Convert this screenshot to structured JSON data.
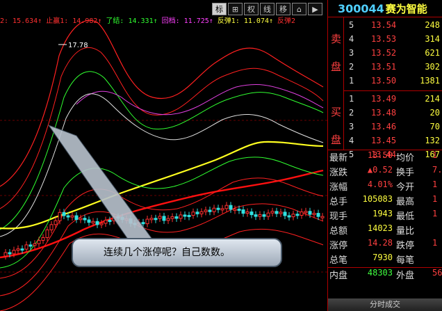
{
  "indicators": [
    {
      "text": "2: 15.634↑",
      "color": "#ff3030"
    },
    {
      "text": "止赢1: 14.982↑",
      "color": "#ff3030"
    },
    {
      "text": "了结: 14.331↑",
      "color": "#30ff30"
    },
    {
      "text": "回档: 11.725↑",
      "color": "#ff40ff"
    },
    {
      "text": "反弹1: 11.074↑",
      "color": "#ffff40"
    },
    {
      "text": "反弹2",
      "color": "#ff3030"
    }
  ],
  "toolbar": [
    "标",
    "⊞",
    "权",
    "线",
    "移",
    "⌂",
    "▶"
  ],
  "peak_label": "17.78",
  "callout_text": "连续几个涨停呢？自己数数。",
  "stock": {
    "code": "300044",
    "name": "赛为智能"
  },
  "sell_label": [
    "卖",
    "盘"
  ],
  "buy_label": [
    "买",
    "盘"
  ],
  "asks": [
    {
      "lvl": "5",
      "px": "13.54",
      "vol": "248"
    },
    {
      "lvl": "4",
      "px": "13.53",
      "vol": "314"
    },
    {
      "lvl": "3",
      "px": "13.52",
      "vol": "621"
    },
    {
      "lvl": "2",
      "px": "13.51",
      "vol": "302"
    },
    {
      "lvl": "1",
      "px": "13.50",
      "vol": "1381"
    }
  ],
  "bids": [
    {
      "lvl": "1",
      "px": "13.49",
      "vol": "214"
    },
    {
      "lvl": "2",
      "px": "13.48",
      "vol": "20"
    },
    {
      "lvl": "3",
      "px": "13.46",
      "vol": "70"
    },
    {
      "lvl": "4",
      "px": "13.45",
      "vol": "132"
    },
    {
      "lvl": "5",
      "px": "13.44",
      "vol": "167"
    }
  ],
  "stats": [
    {
      "l1": "最新",
      "v1": "13.50",
      "c1": "red",
      "l2": "均价",
      "v2": "1"
    },
    {
      "l1": "涨跌",
      "v1": "▲0.52",
      "c1": "red",
      "l2": "换手",
      "v2": "7."
    },
    {
      "l1": "涨幅",
      "v1": "4.01%",
      "c1": "red",
      "l2": "今开",
      "v2": "1"
    },
    {
      "l1": "总手",
      "v1": "105083",
      "c1": "yel",
      "l2": "最高",
      "v2": "1"
    },
    {
      "l1": "现手",
      "v1": "1943",
      "c1": "yel",
      "l2": "最低",
      "v2": "1"
    },
    {
      "l1": "总额",
      "v1": "14023",
      "c1": "yel",
      "l2": "量比",
      "v2": ""
    },
    {
      "l1": "涨停",
      "v1": "14.28",
      "c1": "red",
      "l2": "跌停",
      "v2": "1"
    },
    {
      "l1": "总笔",
      "v1": "7930",
      "c1": "yel",
      "l2": "每笔",
      "v2": ""
    },
    {
      "l1": "内盘",
      "v1": "48303",
      "c1": "grn",
      "l2": "外盘",
      "v2": "56"
    }
  ],
  "tick_tab": "分时成交"
}
